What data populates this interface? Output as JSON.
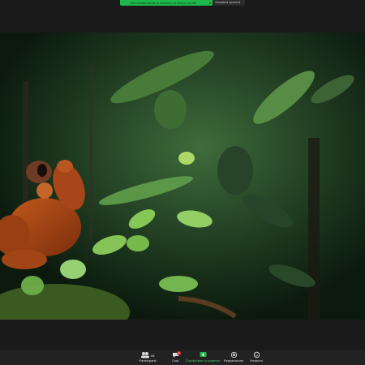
{
  "banner": {
    "sharing_text": "Stai visualizzando lo schermo di Marco Gentili",
    "view_options_label": "Visualizza opzioni"
  },
  "toolbar": {
    "participants_count": "68",
    "participants_label": "Partecipanti",
    "chat_label": "Chat",
    "chat_badge": "2",
    "share_label": "Condividere lo schermo",
    "record_label": "Registrazione",
    "reactions_label": "Reazioni"
  },
  "colors": {
    "accent_green": "#1fb84a",
    "toolbar_bg": "#222222",
    "badge_red": "#e0332d"
  },
  "icons": {
    "participants": "participants-icon",
    "chat": "chat-icon",
    "share": "share-screen-icon",
    "record": "record-icon",
    "reactions": "reactions-icon"
  }
}
